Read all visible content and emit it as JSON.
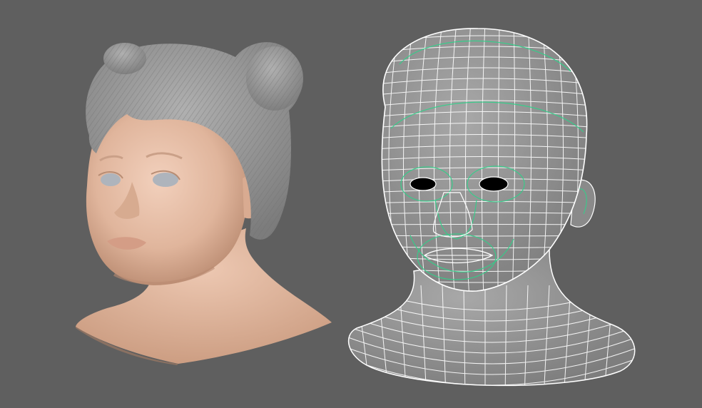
{
  "viewport": {
    "background": "#5f5f5f",
    "content": "3d-render-comparison"
  },
  "models": [
    {
      "id": "shaded-head",
      "style": "shaded",
      "colors": {
        "skin": "#e3b9a1",
        "hair": "#9a9a9a",
        "eyes": "#aeb4bc"
      }
    },
    {
      "id": "wireframe-head",
      "style": "wireframe",
      "colors": {
        "fill": "#9a9a9a",
        "wire": "#ffffff",
        "edge_loops": "#2fd28a",
        "eye_holes": "#000000"
      }
    }
  ]
}
